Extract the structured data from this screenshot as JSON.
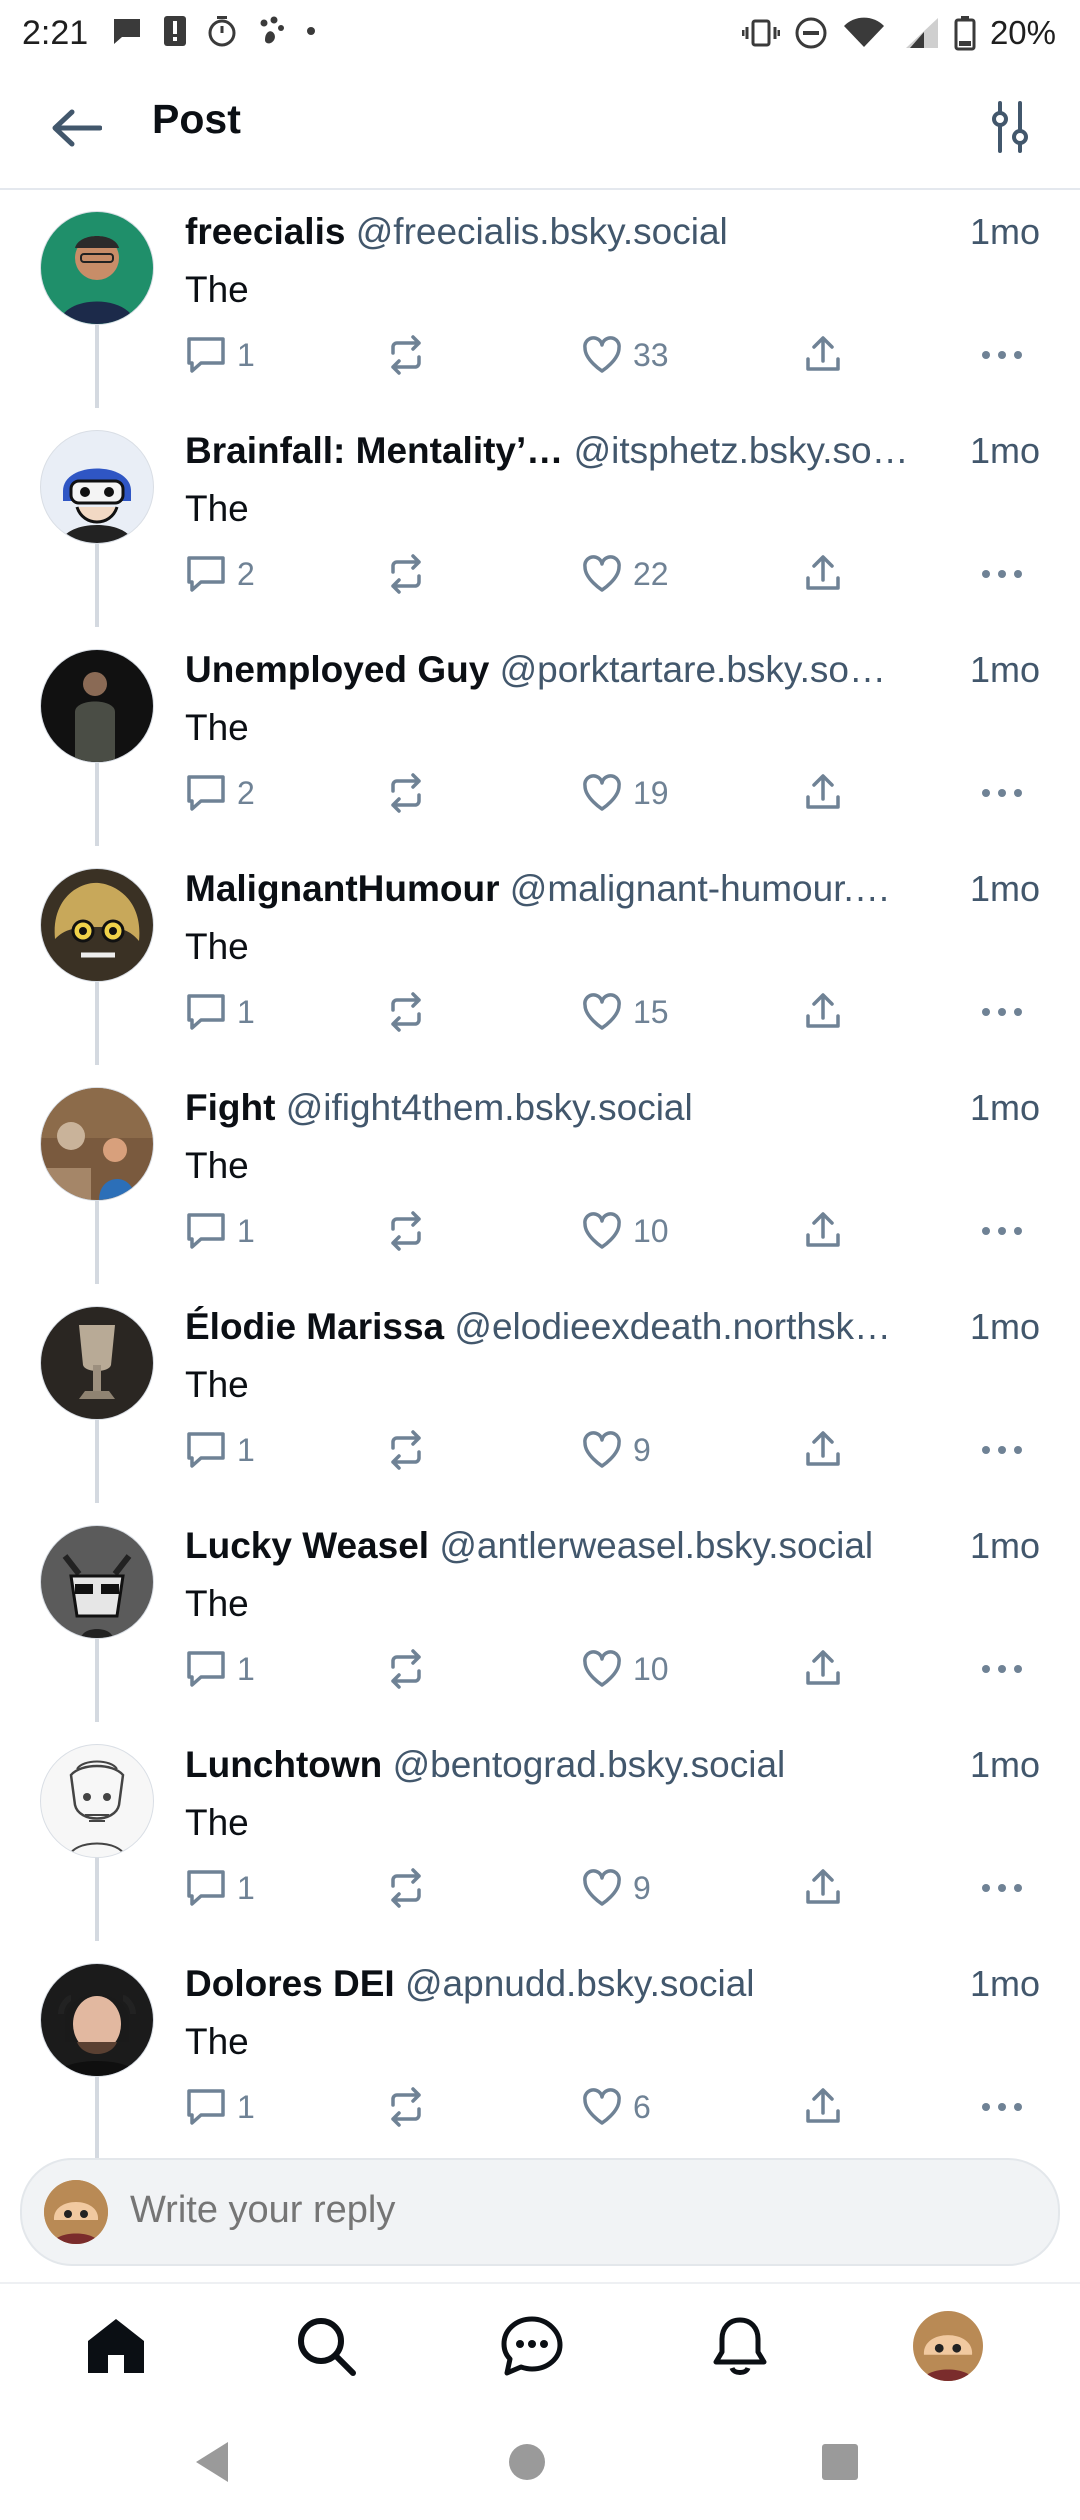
{
  "status_bar": {
    "time": "2:21",
    "battery_percent": "20%",
    "left_icons": [
      "message-icon",
      "alert-icon",
      "timer-icon",
      "pawprint-icon",
      "dot-icon"
    ],
    "right_icons": [
      "vibrate-icon",
      "dnd-icon",
      "wifi-icon",
      "signal-icon",
      "battery-icon"
    ]
  },
  "header": {
    "title": "Post",
    "back_icon": "arrow-left-icon",
    "filter_icon": "sliders-icon"
  },
  "posts": [
    {
      "display_name": "freecialis",
      "handle": "@freecialis.bsky.social",
      "time": "1mo",
      "text": "The",
      "replies": "1",
      "likes": "33"
    },
    {
      "display_name": "Brainfall: Mentality’…",
      "handle": "@itsphetz.bsky.so…",
      "time": "1mo",
      "text": "The",
      "replies": "2",
      "likes": "22"
    },
    {
      "display_name": "Unemployed Guy",
      "handle": "@porktartare.bsky.so…",
      "time": "1mo",
      "text": "The",
      "replies": "2",
      "likes": "19"
    },
    {
      "display_name": "MalignantHumour",
      "handle": "@malignant-humour.…",
      "time": "1mo",
      "text": "The",
      "replies": "1",
      "likes": "15"
    },
    {
      "display_name": "Fight",
      "handle": "@ifight4them.bsky.social",
      "time": "1mo",
      "text": "The",
      "replies": "1",
      "likes": "10"
    },
    {
      "display_name": "Élodie Marissa",
      "handle": "@elodieexdeath.northsk…",
      "time": "1mo",
      "text": "The",
      "replies": "1",
      "likes": "9"
    },
    {
      "display_name": "Lucky Weasel",
      "handle": "@antlerweasel.bsky.social",
      "time": "1mo",
      "text": "The",
      "replies": "1",
      "likes": "10"
    },
    {
      "display_name": "Lunchtown",
      "handle": "@bentograd.bsky.social",
      "time": "1mo",
      "text": "The",
      "replies": "1",
      "likes": "9"
    },
    {
      "display_name": "Dolores DEI",
      "handle": "@apnudd.bsky.social",
      "time": "1mo",
      "text": "The",
      "replies": "1",
      "likes": "6"
    }
  ],
  "reply_bar": {
    "placeholder": "Write your reply"
  },
  "bottom_nav": [
    "home-icon",
    "search-icon",
    "chat-icon",
    "bell-icon",
    "profile-avatar"
  ],
  "system_nav": [
    "back-triangle-icon",
    "home-circle-icon",
    "recents-square-icon"
  ],
  "colors": {
    "text": "#0b0f14",
    "muted": "#42576c",
    "action": "#6f8295",
    "thread_line": "#d4d9e0"
  }
}
